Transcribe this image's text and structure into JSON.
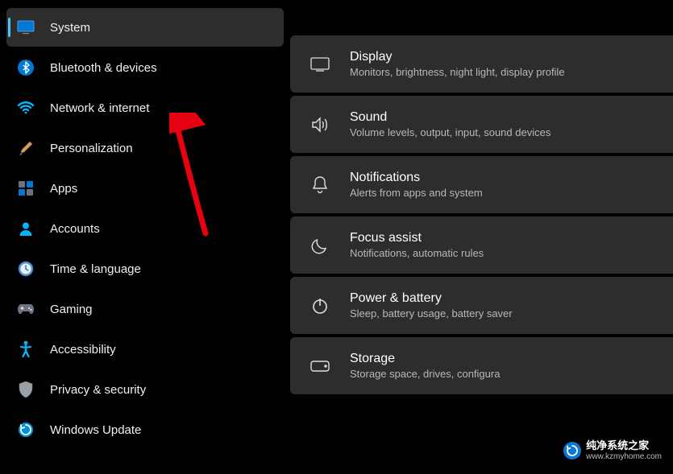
{
  "sidebar": {
    "items": [
      {
        "label": "System",
        "icon": "monitor",
        "active": true
      },
      {
        "label": "Bluetooth & devices",
        "icon": "bluetooth",
        "active": false
      },
      {
        "label": "Network & internet",
        "icon": "wifi",
        "active": false
      },
      {
        "label": "Personalization",
        "icon": "brush",
        "active": false
      },
      {
        "label": "Apps",
        "icon": "apps",
        "active": false
      },
      {
        "label": "Accounts",
        "icon": "person",
        "active": false
      },
      {
        "label": "Time & language",
        "icon": "clock",
        "active": false
      },
      {
        "label": "Gaming",
        "icon": "gamepad",
        "active": false
      },
      {
        "label": "Accessibility",
        "icon": "accessibility",
        "active": false
      },
      {
        "label": "Privacy & security",
        "icon": "shield",
        "active": false
      },
      {
        "label": "Windows Update",
        "icon": "update",
        "active": false
      }
    ]
  },
  "main": {
    "cards": [
      {
        "title": "Display",
        "desc": "Monitors, brightness, night light, display profile",
        "icon": "display"
      },
      {
        "title": "Sound",
        "desc": "Volume levels, output, input, sound devices",
        "icon": "sound"
      },
      {
        "title": "Notifications",
        "desc": "Alerts from apps and system",
        "icon": "bell"
      },
      {
        "title": "Focus assist",
        "desc": "Notifications, automatic rules",
        "icon": "moon"
      },
      {
        "title": "Power & battery",
        "desc": "Sleep, battery usage, battery saver",
        "icon": "power"
      },
      {
        "title": "Storage",
        "desc": "Storage space, drives, configura",
        "icon": "storage"
      }
    ]
  },
  "watermark": {
    "line1": "纯净系统之家",
    "line2": "www.kzmyhome.com"
  },
  "colors": {
    "accent": "#4cc2ff",
    "cardBg": "#2d2d2d",
    "arrow": "#e60012"
  }
}
